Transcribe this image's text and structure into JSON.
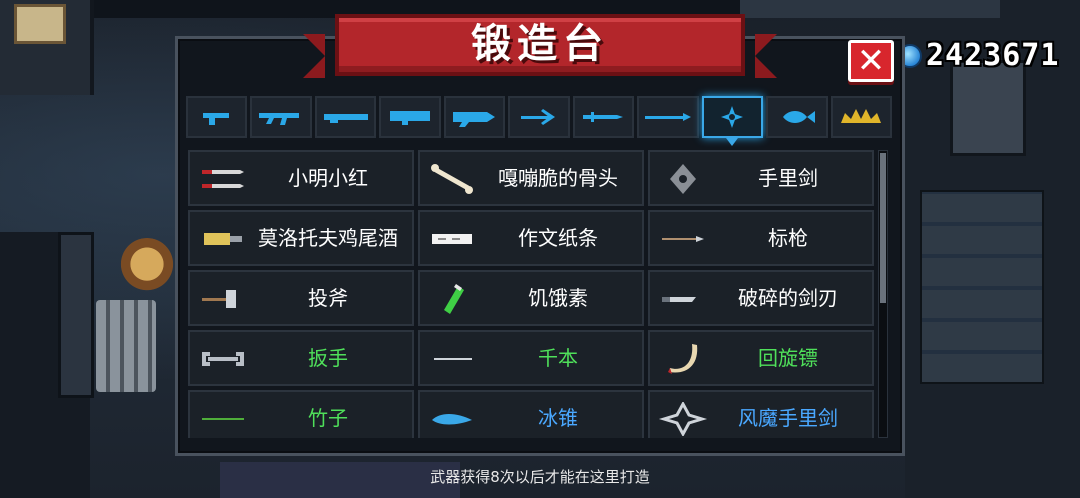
{
  "title": "锻造台",
  "currency": {
    "icon": "gem-icon",
    "amount": "2423671"
  },
  "close_icon": "close-icon",
  "tabs": [
    {
      "icon": "pistol-icon"
    },
    {
      "icon": "assault-rifle-icon"
    },
    {
      "icon": "shotgun-icon"
    },
    {
      "icon": "rocket-launcher-icon"
    },
    {
      "icon": "laser-gun-icon"
    },
    {
      "icon": "bow-icon"
    },
    {
      "icon": "sword-icon"
    },
    {
      "icon": "spear-icon"
    },
    {
      "icon": "throwing-star-icon",
      "active": true
    },
    {
      "icon": "fish-icon"
    },
    {
      "icon": "crown-icon"
    }
  ],
  "weapons": [
    {
      "name": "小明小红",
      "color": "white",
      "icon": "twin-daggers-icon"
    },
    {
      "name": "嘎嘣脆的骨头",
      "color": "white",
      "icon": "bone-icon"
    },
    {
      "name": "手里剑",
      "color": "white",
      "icon": "shuriken-icon"
    },
    {
      "name": "莫洛托夫鸡尾酒",
      "color": "white",
      "icon": "molotov-icon"
    },
    {
      "name": "作文纸条",
      "color": "white",
      "icon": "paper-note-icon"
    },
    {
      "name": "标枪",
      "color": "white",
      "icon": "javelin-icon"
    },
    {
      "name": "投斧",
      "color": "white",
      "icon": "throwing-axe-icon"
    },
    {
      "name": "饥饿素",
      "color": "white",
      "icon": "green-potion-icon"
    },
    {
      "name": "破碎的剑刃",
      "color": "white",
      "icon": "broken-blade-icon"
    },
    {
      "name": "扳手",
      "color": "green",
      "icon": "wrench-icon"
    },
    {
      "name": "千本",
      "color": "green",
      "icon": "needle-icon"
    },
    {
      "name": "回旋镖",
      "color": "green",
      "icon": "boomerang-icon"
    },
    {
      "name": "竹子",
      "color": "green",
      "icon": "bamboo-icon"
    },
    {
      "name": "冰锥",
      "color": "blue",
      "icon": "ice-spike-icon"
    },
    {
      "name": "风魔手里剑",
      "color": "blue",
      "icon": "fuma-shuriken-icon"
    }
  ],
  "hint": "武器获得8次以后才能在这里打造"
}
